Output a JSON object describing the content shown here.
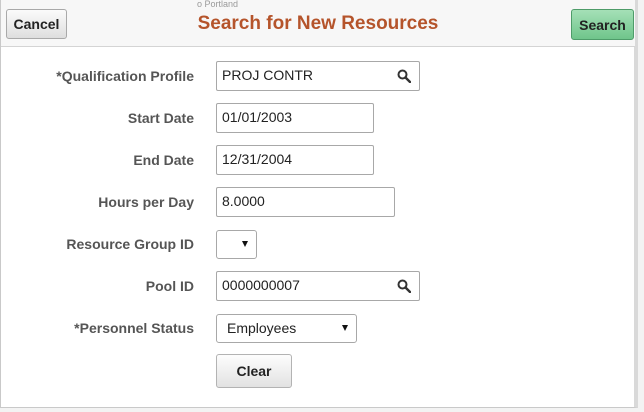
{
  "header": {
    "title": "Search for New Resources",
    "cancel_label": "Cancel",
    "search_label": "Search",
    "background_text": "o Portland"
  },
  "form": {
    "qualification_profile": {
      "label": "*Qualification Profile",
      "value": "PROJ CONTR"
    },
    "start_date": {
      "label": "Start Date",
      "value": "01/01/2003"
    },
    "end_date": {
      "label": "End Date",
      "value": "12/31/2004"
    },
    "hours_per_day": {
      "label": "Hours per Day",
      "value": "8.0000"
    },
    "resource_group_id": {
      "label": "Resource Group ID",
      "value": ""
    },
    "pool_id": {
      "label": "Pool ID",
      "value": "0000000007"
    },
    "personnel_status": {
      "label": "*Personnel Status",
      "value": "Employees"
    },
    "clear_label": "Clear"
  },
  "colors": {
    "title": "#b5542b",
    "search_button": "#6fc58b"
  },
  "icons": {
    "lookup": "magnifier-icon",
    "dropdown": "chevron-down-icon"
  }
}
